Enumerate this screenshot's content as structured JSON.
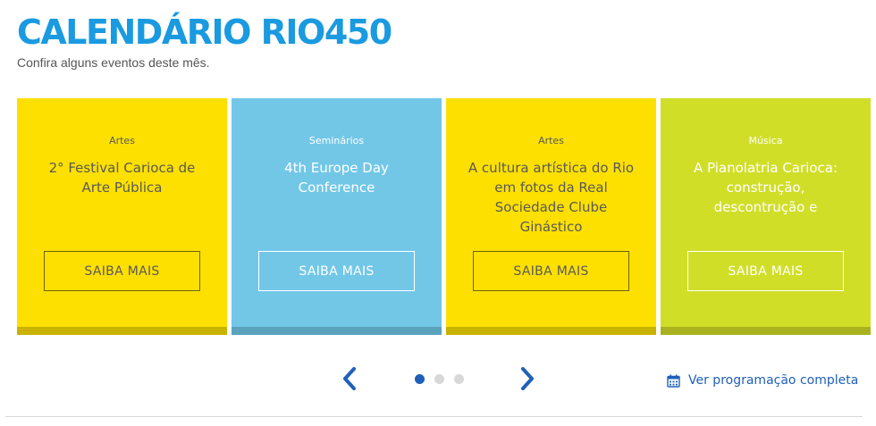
{
  "header": {
    "title": "CALENDÁRIO RIO450",
    "subtitle": "Confira alguns eventos deste mês."
  },
  "cards": [
    {
      "category": "Artes",
      "title": "2° Festival Carioca de Arte Pública",
      "button": "SAIBA MAIS",
      "color": "#fde000"
    },
    {
      "category": "Seminários",
      "title": "4th Europe Day Conference",
      "button": "SAIBA MAIS",
      "color": "#72c7e7"
    },
    {
      "category": "Artes",
      "title": "A cultura artística do Rio em fotos da Real Sociedade Clube Ginástico",
      "button": "SAIBA MAIS",
      "color": "#fde000"
    },
    {
      "category": "Música",
      "title": "A Pianolatria Carioca: construção, descontrução e",
      "button": "SAIBA MAIS",
      "color": "#d1de28"
    }
  ],
  "carousel": {
    "prev_icon": "chevron-left-icon",
    "next_icon": "chevron-right-icon",
    "pages": 3,
    "active_page": 1
  },
  "footer_link": {
    "label": "Ver programação completa",
    "icon": "calendar-icon"
  },
  "colors": {
    "title": "#1a9ae0",
    "link": "#2060b8"
  }
}
